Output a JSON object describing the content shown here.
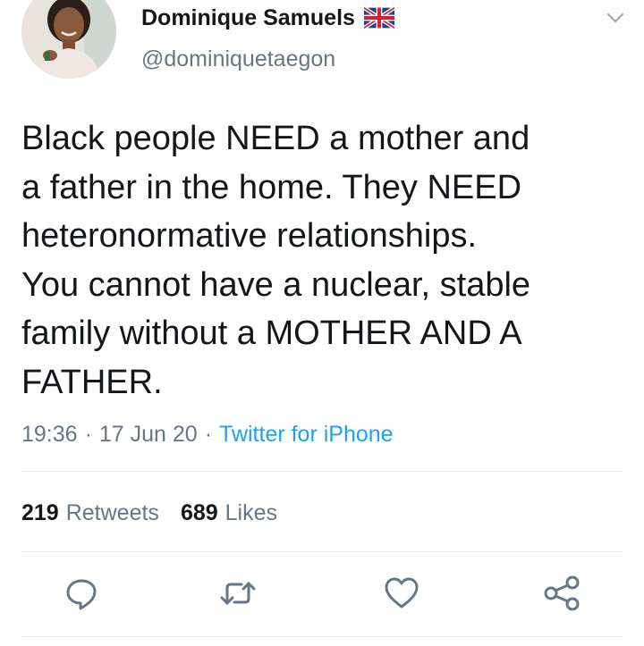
{
  "user": {
    "display_name": "Dominique Samuels",
    "flag_icon": "uk-flag-icon",
    "handle": "@dominiquetaegon"
  },
  "tweet": {
    "text": "Black people NEED a mother and\na father in the home. They NEED\nheteronormative relationships.\nYou cannot have a nuclear, stable\nfamily without a MOTHER AND A\nFATHER.",
    "time": "19:36",
    "date": "17 Jun 20",
    "separator": "·",
    "source": "Twitter for iPhone"
  },
  "stats": {
    "retweets_count": "219",
    "retweets_label": "Retweets",
    "likes_count": "689",
    "likes_label": "Likes"
  },
  "actions": [
    "reply-icon",
    "retweet-icon",
    "like-icon",
    "share-icon"
  ],
  "colors": {
    "text": "#14171a",
    "secondary": "#657786",
    "link": "#1da1f2",
    "divider": "#e6ecf0"
  }
}
